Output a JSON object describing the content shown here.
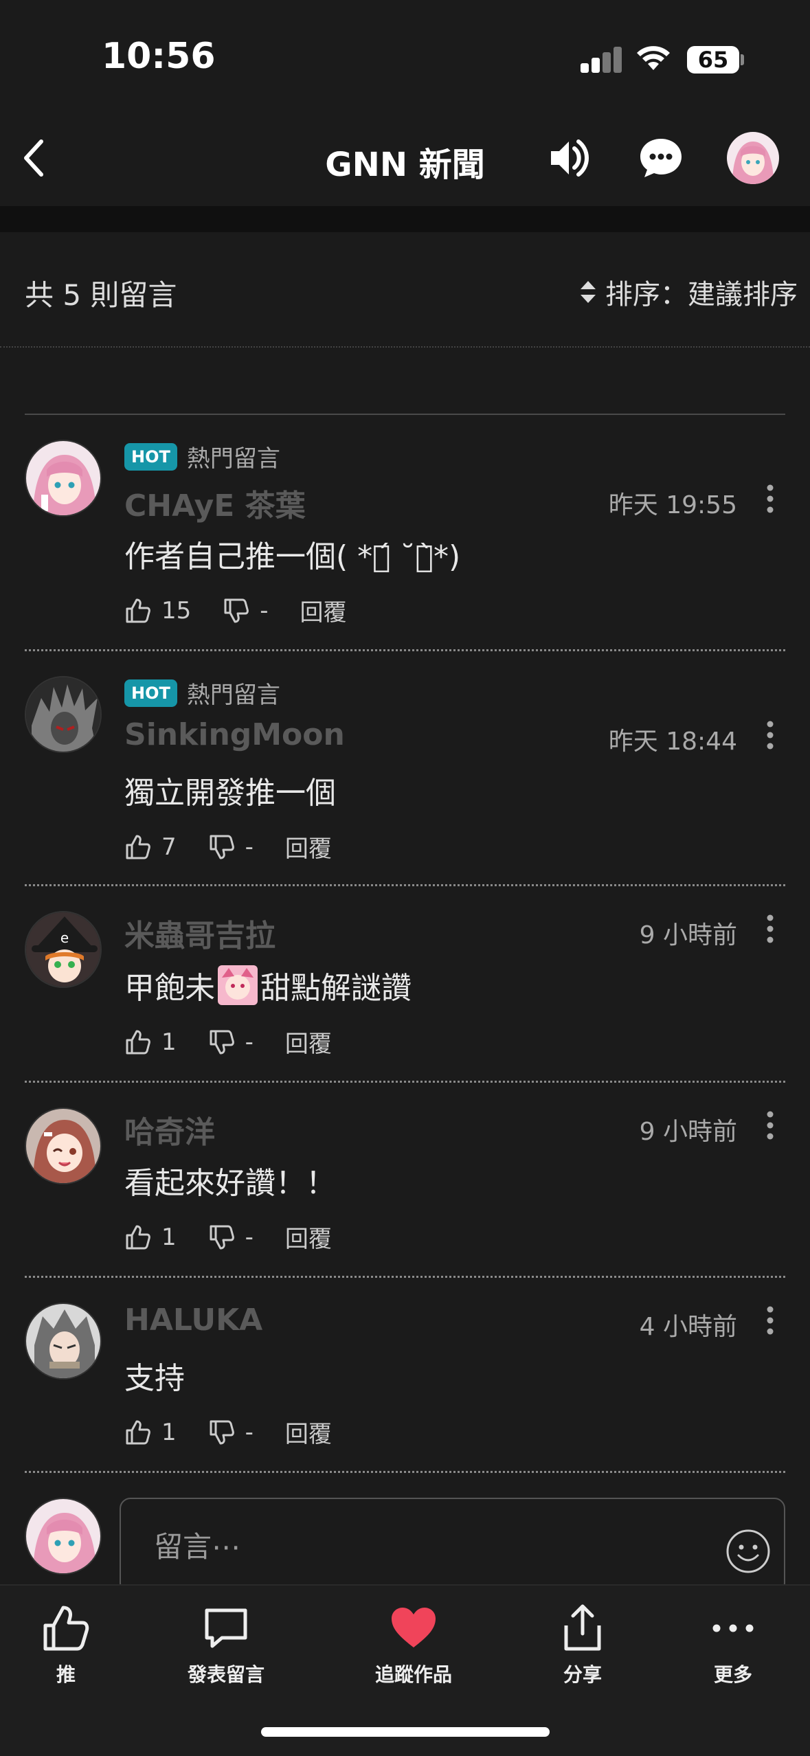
{
  "status_bar": {
    "time": "10:56",
    "battery": "65"
  },
  "header": {
    "title": "GNN 新聞"
  },
  "comments_header": {
    "count_text": "共 5 則留言",
    "sort_text": "排序：建議排序"
  },
  "comments": [
    {
      "hot": true,
      "hot_badge": "HOT",
      "hot_label": "熱門留言",
      "user": "CHAyE 茶葉",
      "time": "昨天 19:55",
      "text": "作者自己推一個( *ต́ ˘ต̀*)",
      "likes": "15",
      "dislikes": "-",
      "reply": "回覆"
    },
    {
      "hot": true,
      "hot_badge": "HOT",
      "hot_label": "熱門留言",
      "user": "SinkingMoon",
      "time": "昨天 18:44",
      "text": "獨立開發推一個",
      "likes": "7",
      "dislikes": "-",
      "reply": "回覆"
    },
    {
      "hot": false,
      "user": "米蟲哥吉拉",
      "time": "9 小時前",
      "text_before": "甲飽未",
      "text_after": "甜點解謎讚",
      "likes": "1",
      "dislikes": "-",
      "reply": "回覆"
    },
    {
      "hot": false,
      "user": "哈奇洋",
      "time": "9 小時前",
      "text": "看起來好讚！！",
      "likes": "1",
      "dislikes": "-",
      "reply": "回覆"
    },
    {
      "hot": false,
      "user": "HALUKA",
      "time": "4 小時前",
      "text": "支持",
      "likes": "1",
      "dislikes": "-",
      "reply": "回覆"
    }
  ],
  "input": {
    "placeholder": "留言⋯"
  },
  "bottom_bar": {
    "tabs": [
      {
        "label": "推",
        "icon": "thumbs-up-icon"
      },
      {
        "label": "發表留言",
        "icon": "speech-bubble-icon"
      },
      {
        "label": "追蹤作品",
        "icon": "heart-icon"
      },
      {
        "label": "分享",
        "icon": "share-icon"
      },
      {
        "label": "更多",
        "icon": "more-horizontal-icon"
      }
    ]
  },
  "colors": {
    "background": "#1b1b1b",
    "hot_badge": "#1696a8",
    "heart": "#f0445a",
    "username": "#5a5a5a"
  }
}
